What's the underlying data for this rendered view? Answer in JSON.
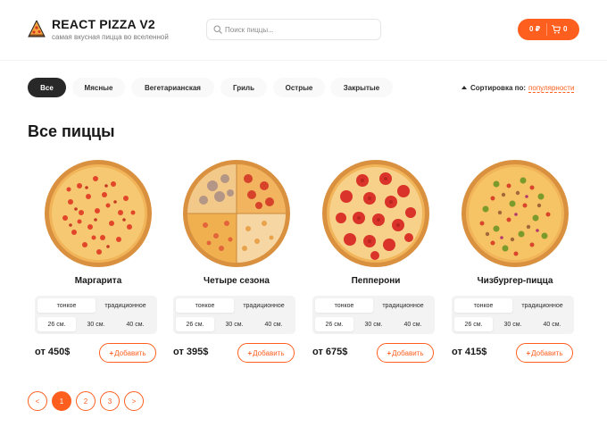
{
  "header": {
    "title": "REACT PIZZA V2",
    "subtitle": "самая вкусная пицца во вселенной",
    "search_placeholder": "Поиск пиццы...",
    "cart_price": "0 ₽",
    "cart_count": "0",
    "accent_color": "#fe5f1e"
  },
  "categories": [
    "Все",
    "Мясные",
    "Вегетарианская",
    "Гриль",
    "Острые",
    "Закрытые"
  ],
  "active_category": "Все",
  "sort": {
    "label": "Сортировка по:",
    "value": "популярности"
  },
  "page_title": "Все пиццы",
  "pizzas": [
    {
      "name": "Маргарита",
      "price": "от 450$",
      "types": [
        "тонкое",
        "традиционное"
      ],
      "sizes": [
        "26 см.",
        "30 см.",
        "40 см."
      ],
      "add_label": "Добавить"
    },
    {
      "name": "Четыре сезона",
      "price": "от 395$",
      "types": [
        "тонкое",
        "традиционное"
      ],
      "sizes": [
        "26 см.",
        "30 см.",
        "40 см."
      ],
      "add_label": "Добавить"
    },
    {
      "name": "Пепперони",
      "price": "от 675$",
      "types": [
        "тонкое",
        "традиционное"
      ],
      "sizes": [
        "26 см.",
        "30 см.",
        "40 см."
      ],
      "add_label": "Добавить"
    },
    {
      "name": "Чизбургер-пицца",
      "price": "от 415$",
      "types": [
        "тонкое",
        "традиционное"
      ],
      "sizes": [
        "26 см.",
        "30 см.",
        "40 см."
      ],
      "add_label": "Добавить"
    }
  ],
  "pagination": {
    "prev": "<",
    "pages": [
      "1",
      "2",
      "3"
    ],
    "next": ">",
    "current": "1"
  }
}
